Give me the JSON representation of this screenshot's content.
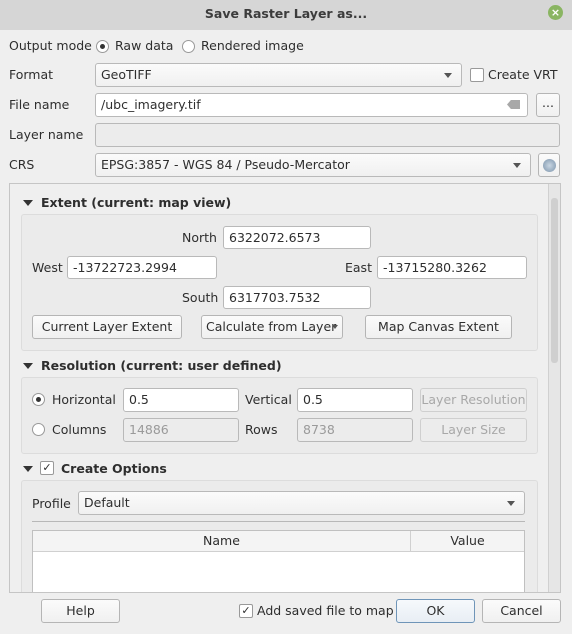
{
  "window": {
    "title": "Save Raster Layer as..."
  },
  "output_mode": {
    "label": "Output mode",
    "raw": "Raw data",
    "rendered": "Rendered image",
    "selected": "Raw data"
  },
  "format": {
    "label": "Format",
    "value": "GeoTIFF",
    "create_vrt": "Create VRT",
    "create_vrt_checked": false
  },
  "file_name": {
    "label": "File name",
    "value": "/ubc_imagery.tif",
    "browse": "..."
  },
  "layer_name": {
    "label": "Layer name",
    "value": ""
  },
  "crs": {
    "label": "CRS",
    "value": "EPSG:3857 - WGS 84 / Pseudo-Mercator"
  },
  "extent": {
    "header": "Extent (current: map view)",
    "north_label": "North",
    "north": "6322072.6573",
    "west_label": "West",
    "west": "-13722723.2994",
    "east_label": "East",
    "east": "-13715280.3262",
    "south_label": "South",
    "south": "6317703.7532",
    "btn_current": "Current Layer Extent",
    "btn_calc": "Calculate from Layer",
    "btn_canvas": "Map Canvas Extent"
  },
  "resolution": {
    "header": "Resolution (current: user defined)",
    "horizontal_label": "Horizontal",
    "horizontal": "0.5",
    "vertical_label": "Vertical",
    "vertical": "0.5",
    "btn_layer_res": "Layer Resolution",
    "columns_label": "Columns",
    "columns": "14886",
    "rows_label": "Rows",
    "rows": "8738",
    "btn_layer_size": "Layer Size",
    "selected": "Horizontal"
  },
  "create_options": {
    "header": "Create Options",
    "checked": true,
    "profile_label": "Profile",
    "profile": "Default",
    "columns": [
      "Name",
      "Value"
    ]
  },
  "footer": {
    "help": "Help",
    "add_to_map": "Add saved file to map",
    "add_to_map_checked": true,
    "ok": "OK",
    "cancel": "Cancel"
  }
}
